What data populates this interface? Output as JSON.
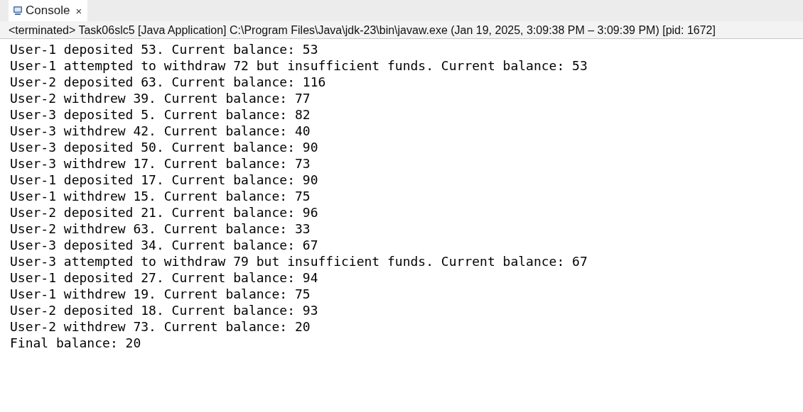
{
  "tabs": [
    {
      "label": "Console",
      "selected": true,
      "close": "×"
    }
  ],
  "status": "<terminated> Task06slc5 [Java Application] C:\\Program Files\\Java\\jdk-23\\bin\\javaw.exe  (Jan 19, 2025, 3:09:38 PM – 3:09:39 PM) [pid: 1672]",
  "output": [
    "User-1 deposited 53. Current balance: 53",
    "User-1 attempted to withdraw 72 but insufficient funds. Current balance: 53",
    "User-2 deposited 63. Current balance: 116",
    "User-2 withdrew 39. Current balance: 77",
    "User-3 deposited 5. Current balance: 82",
    "User-3 withdrew 42. Current balance: 40",
    "User-3 deposited 50. Current balance: 90",
    "User-3 withdrew 17. Current balance: 73",
    "User-1 deposited 17. Current balance: 90",
    "User-1 withdrew 15. Current balance: 75",
    "User-2 deposited 21. Current balance: 96",
    "User-2 withdrew 63. Current balance: 33",
    "User-3 deposited 34. Current balance: 67",
    "User-3 attempted to withdraw 79 but insufficient funds. Current balance: 67",
    "User-1 deposited 27. Current balance: 94",
    "User-1 withdrew 19. Current balance: 75",
    "User-2 deposited 18. Current balance: 93",
    "User-2 withdrew 73. Current balance: 20",
    "Final balance: 20"
  ]
}
